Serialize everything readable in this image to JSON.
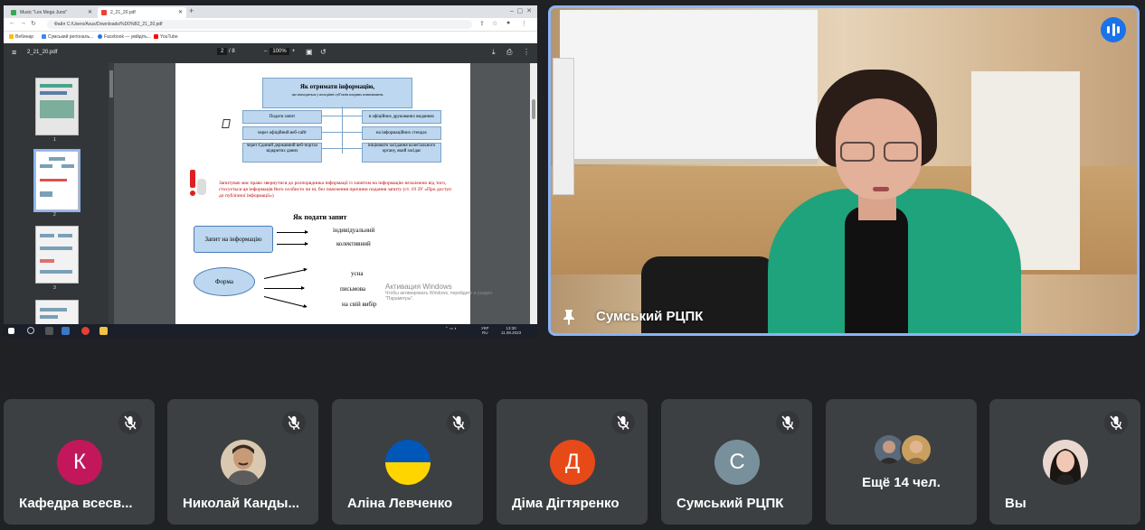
{
  "browser": {
    "tabs": [
      {
        "label": "Music \"Lex Mega Juno\"",
        "active": false
      },
      {
        "label": "2_21_20.pdf",
        "active": true
      }
    ],
    "address": "Файл  C:/Users/Asus/Downloads/%D0%B2_21_20.pdf",
    "bookmarks": [
      "Вебинар",
      "Сумський регіональ...",
      "Facebook — увійдіть...",
      "YouTube"
    ]
  },
  "pdf_viewer": {
    "filename": "2_21_20.pdf",
    "page_current": "2",
    "page_total": "/  8",
    "zoom": "100%",
    "thumb_numbers": [
      "1",
      "2",
      "3",
      "4"
    ]
  },
  "document": {
    "title": "Як отримати інформацію,",
    "subtitle": "що знаходиться у володінні суб'єктів владних повноважень",
    "left_boxes": [
      "Подати запит",
      "через офіційний веб-сайт",
      "через Єдиний державний веб-портал відкритих даних"
    ],
    "right_boxes": [
      "в офіційних друкованих виданнях",
      "на інформаційних стендах",
      "ініціювати засідання колегіального органу, який засідає"
    ],
    "warning": "Запитувач має право звернутися до розпорядника інформації із запитом на інформацію незалежно від того, стосується ця інформація його особисто чи ні, без пояснення причини подання запиту (ст. 19 ЗУ «Про доступ до публічної інформації»)",
    "how_title": "Як подати запит",
    "request_box": "Запит на інформацію",
    "request_types": [
      "індивідуальний",
      "колективний"
    ],
    "form_label": "Форма",
    "form_types": [
      "усна",
      "письмова",
      "на свій вибір"
    ],
    "activation_title": "Активация Windows",
    "activation_text": "Чтобы активировать Windows, перейдите в раздел \"Параметры\"."
  },
  "taskbar": {
    "lang": "УКР",
    "lang2": "RU",
    "time": "13:30",
    "date": "11.08.2023"
  },
  "speaker": {
    "name": "Сумський РЦПК"
  },
  "participants": [
    {
      "name": "Кафедра всесв...",
      "initial": "К",
      "color": "#c2185b"
    },
    {
      "name": "Николай Канды...",
      "initial": "",
      "color": "#d9c9b0"
    },
    {
      "name": "Аліна Левченко",
      "initial": "",
      "color": "#ffd500"
    },
    {
      "name": "Діма Дігтяренко",
      "initial": "Д",
      "color": "#e64a19"
    },
    {
      "name": "Сумський РЦПК",
      "initial": "С",
      "color": "#78909c"
    },
    {
      "more": "Ещё 14 чел."
    },
    {
      "name": "Вы",
      "initial": "",
      "color": "#f0c0c0"
    }
  ],
  "colors": {
    "background": "#202124",
    "tile": "#3c4043",
    "active_border": "#8ab4f8"
  }
}
